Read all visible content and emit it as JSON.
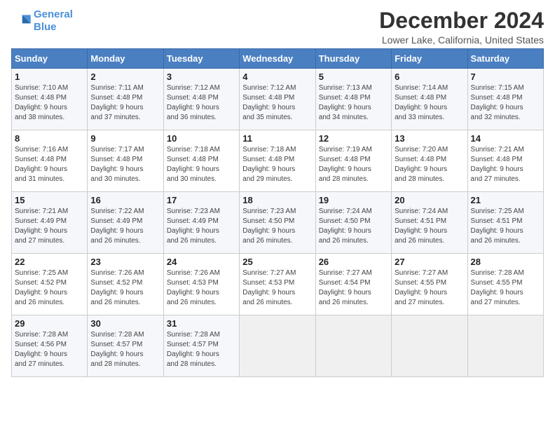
{
  "header": {
    "logo_line1": "General",
    "logo_line2": "Blue",
    "title": "December 2024",
    "location": "Lower Lake, California, United States"
  },
  "columns": [
    "Sunday",
    "Monday",
    "Tuesday",
    "Wednesday",
    "Thursday",
    "Friday",
    "Saturday"
  ],
  "weeks": [
    [
      {
        "day": "1",
        "info": "Sunrise: 7:10 AM\nSunset: 4:48 PM\nDaylight: 9 hours\nand 38 minutes."
      },
      {
        "day": "2",
        "info": "Sunrise: 7:11 AM\nSunset: 4:48 PM\nDaylight: 9 hours\nand 37 minutes."
      },
      {
        "day": "3",
        "info": "Sunrise: 7:12 AM\nSunset: 4:48 PM\nDaylight: 9 hours\nand 36 minutes."
      },
      {
        "day": "4",
        "info": "Sunrise: 7:12 AM\nSunset: 4:48 PM\nDaylight: 9 hours\nand 35 minutes."
      },
      {
        "day": "5",
        "info": "Sunrise: 7:13 AM\nSunset: 4:48 PM\nDaylight: 9 hours\nand 34 minutes."
      },
      {
        "day": "6",
        "info": "Sunrise: 7:14 AM\nSunset: 4:48 PM\nDaylight: 9 hours\nand 33 minutes."
      },
      {
        "day": "7",
        "info": "Sunrise: 7:15 AM\nSunset: 4:48 PM\nDaylight: 9 hours\nand 32 minutes."
      }
    ],
    [
      {
        "day": "8",
        "info": "Sunrise: 7:16 AM\nSunset: 4:48 PM\nDaylight: 9 hours\nand 31 minutes."
      },
      {
        "day": "9",
        "info": "Sunrise: 7:17 AM\nSunset: 4:48 PM\nDaylight: 9 hours\nand 30 minutes."
      },
      {
        "day": "10",
        "info": "Sunrise: 7:18 AM\nSunset: 4:48 PM\nDaylight: 9 hours\nand 30 minutes."
      },
      {
        "day": "11",
        "info": "Sunrise: 7:18 AM\nSunset: 4:48 PM\nDaylight: 9 hours\nand 29 minutes."
      },
      {
        "day": "12",
        "info": "Sunrise: 7:19 AM\nSunset: 4:48 PM\nDaylight: 9 hours\nand 28 minutes."
      },
      {
        "day": "13",
        "info": "Sunrise: 7:20 AM\nSunset: 4:48 PM\nDaylight: 9 hours\nand 28 minutes."
      },
      {
        "day": "14",
        "info": "Sunrise: 7:21 AM\nSunset: 4:48 PM\nDaylight: 9 hours\nand 27 minutes."
      }
    ],
    [
      {
        "day": "15",
        "info": "Sunrise: 7:21 AM\nSunset: 4:49 PM\nDaylight: 9 hours\nand 27 minutes."
      },
      {
        "day": "16",
        "info": "Sunrise: 7:22 AM\nSunset: 4:49 PM\nDaylight: 9 hours\nand 26 minutes."
      },
      {
        "day": "17",
        "info": "Sunrise: 7:23 AM\nSunset: 4:49 PM\nDaylight: 9 hours\nand 26 minutes."
      },
      {
        "day": "18",
        "info": "Sunrise: 7:23 AM\nSunset: 4:50 PM\nDaylight: 9 hours\nand 26 minutes."
      },
      {
        "day": "19",
        "info": "Sunrise: 7:24 AM\nSunset: 4:50 PM\nDaylight: 9 hours\nand 26 minutes."
      },
      {
        "day": "20",
        "info": "Sunrise: 7:24 AM\nSunset: 4:51 PM\nDaylight: 9 hours\nand 26 minutes."
      },
      {
        "day": "21",
        "info": "Sunrise: 7:25 AM\nSunset: 4:51 PM\nDaylight: 9 hours\nand 26 minutes."
      }
    ],
    [
      {
        "day": "22",
        "info": "Sunrise: 7:25 AM\nSunset: 4:52 PM\nDaylight: 9 hours\nand 26 minutes."
      },
      {
        "day": "23",
        "info": "Sunrise: 7:26 AM\nSunset: 4:52 PM\nDaylight: 9 hours\nand 26 minutes."
      },
      {
        "day": "24",
        "info": "Sunrise: 7:26 AM\nSunset: 4:53 PM\nDaylight: 9 hours\nand 26 minutes."
      },
      {
        "day": "25",
        "info": "Sunrise: 7:27 AM\nSunset: 4:53 PM\nDaylight: 9 hours\nand 26 minutes."
      },
      {
        "day": "26",
        "info": "Sunrise: 7:27 AM\nSunset: 4:54 PM\nDaylight: 9 hours\nand 26 minutes."
      },
      {
        "day": "27",
        "info": "Sunrise: 7:27 AM\nSunset: 4:55 PM\nDaylight: 9 hours\nand 27 minutes."
      },
      {
        "day": "28",
        "info": "Sunrise: 7:28 AM\nSunset: 4:55 PM\nDaylight: 9 hours\nand 27 minutes."
      }
    ],
    [
      {
        "day": "29",
        "info": "Sunrise: 7:28 AM\nSunset: 4:56 PM\nDaylight: 9 hours\nand 27 minutes."
      },
      {
        "day": "30",
        "info": "Sunrise: 7:28 AM\nSunset: 4:57 PM\nDaylight: 9 hours\nand 28 minutes."
      },
      {
        "day": "31",
        "info": "Sunrise: 7:28 AM\nSunset: 4:57 PM\nDaylight: 9 hours\nand 28 minutes."
      },
      null,
      null,
      null,
      null
    ]
  ]
}
